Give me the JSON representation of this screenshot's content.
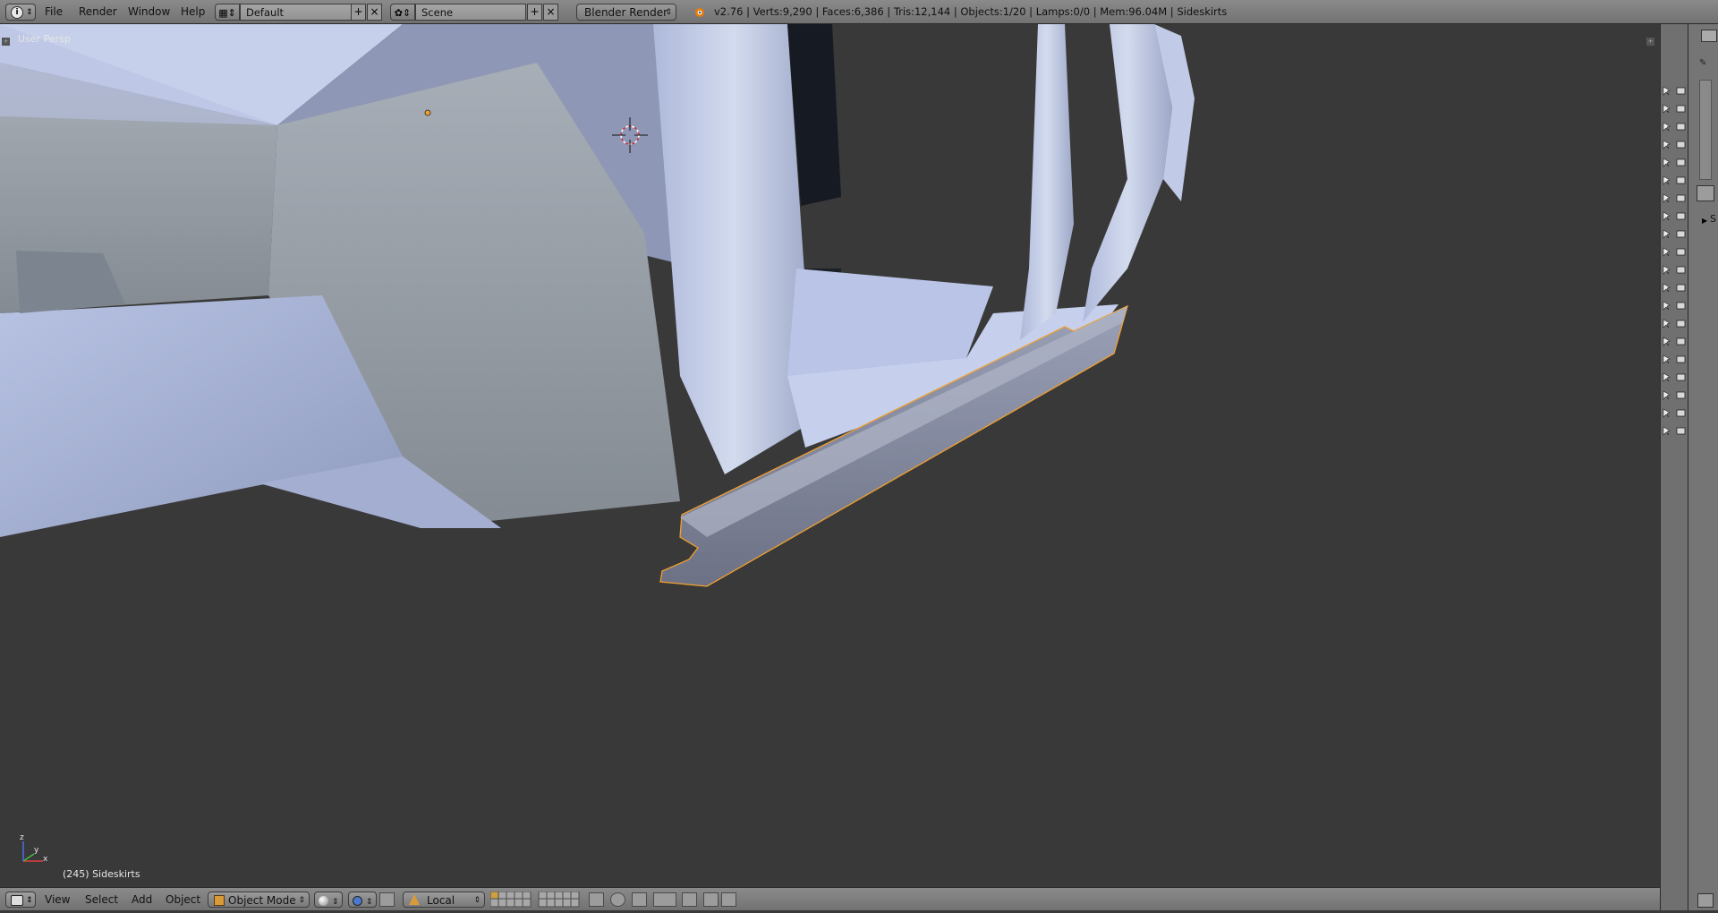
{
  "topbar": {
    "menus": [
      "File",
      "Render",
      "Window",
      "Help"
    ],
    "screen_layout": "Default",
    "scene": "Scene",
    "render_engine": "Blender Render",
    "stats": "v2.76 | Verts:9,290 | Faces:6,386 | Tris:12,144 | Objects:1/20 | Lamps:0/0 | Mem:96.04M | Sideskirts"
  },
  "viewport": {
    "view_name": "User Persp",
    "object_info": "(245) Sideskirts",
    "axis_labels": {
      "x": "x",
      "y": "y",
      "z": "z"
    }
  },
  "bottombar": {
    "menus": [
      "View",
      "Select",
      "Add",
      "Object"
    ],
    "mode": "Object Mode",
    "pivot": "Local"
  },
  "properties": {
    "section_label": "S"
  },
  "colors": {
    "header": "#7d7d7d",
    "viewport_bg": "#393939",
    "selection": "#f0a030",
    "mesh": "#a9b4d8"
  },
  "icons": [
    "info-icon",
    "screen-layout-icon",
    "scene-icon",
    "blender-logo-icon",
    "view3d-icon",
    "cube-icon",
    "sphere-icon",
    "pivot-icon",
    "layer-buttons",
    "camera-icon",
    "cursor-icon",
    "restrict-view-icon"
  ]
}
